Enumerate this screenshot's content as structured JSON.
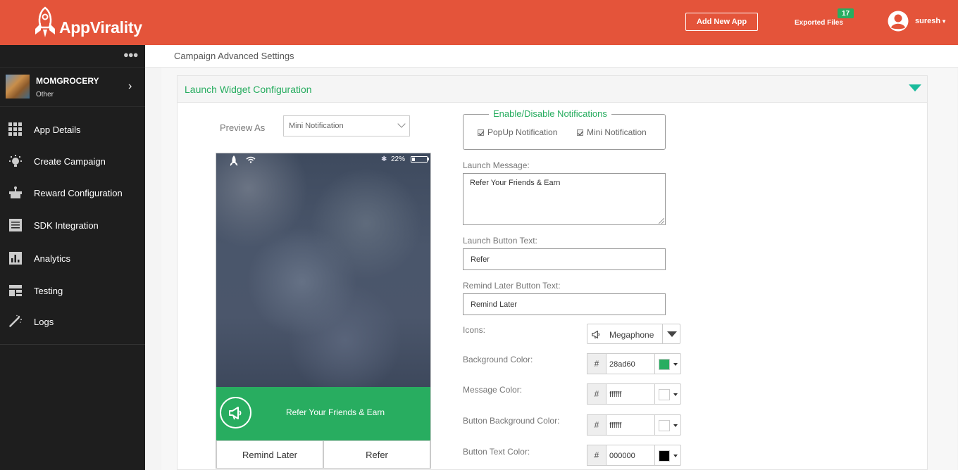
{
  "header": {
    "brand": "AppVirality",
    "add_app_label": "Add New App",
    "exported_label": "Exported Files",
    "exported_count": "17",
    "username": "suresh",
    "colors": {
      "topbar": "#e4543a",
      "accent": "#28ad60"
    }
  },
  "sidebar": {
    "app_name": "MOMGROCERY",
    "app_type": "Other",
    "items": [
      {
        "label": "App Details",
        "icon": "grid-icon"
      },
      {
        "label": "Create Campaign",
        "icon": "bulb-icon"
      },
      {
        "label": "Reward Configuration",
        "icon": "gift-icon"
      },
      {
        "label": "SDK Integration",
        "icon": "list-icon"
      },
      {
        "label": "Analytics",
        "icon": "bar-chart-icon"
      },
      {
        "label": "Testing",
        "icon": "dashboard-icon"
      },
      {
        "label": "Logs",
        "icon": "magic-wand-icon"
      }
    ]
  },
  "breadcrumb": "Campaign Advanced Settings",
  "section": {
    "title": "Launch Widget Configuration"
  },
  "preview": {
    "label": "Preview As",
    "selected": "Mini Notification",
    "phone": {
      "battery": "22%",
      "battery_level": 0.22,
      "notification_text": "Refer Your Friends & Earn",
      "remind_button": "Remind Later",
      "refer_button": "Refer"
    }
  },
  "form": {
    "notifications_legend": "Enable/Disable Notifications",
    "popup_label": "PopUp Notification",
    "mini_label": "Mini Notification",
    "launch_message_label": "Launch Message:",
    "launch_message_value": "Refer Your Friends & Earn",
    "launch_button_label": "Launch Button Text:",
    "launch_button_value": "Refer",
    "remind_label": "Remind Later Button Text:",
    "remind_value": "Remind Later",
    "icons_label": "Icons:",
    "icon_selected": "Megaphone",
    "hash": "#",
    "colors": [
      {
        "label": "Background Color:",
        "value": "28ad60",
        "swatch": "#28ad60"
      },
      {
        "label": "Message Color:",
        "value": "ffffff",
        "swatch": "#ffffff"
      },
      {
        "label": "Button Background Color:",
        "value": "ffffff",
        "swatch": "#ffffff"
      },
      {
        "label": "Button Text Color:",
        "value": "000000",
        "swatch": "#000000"
      }
    ]
  }
}
